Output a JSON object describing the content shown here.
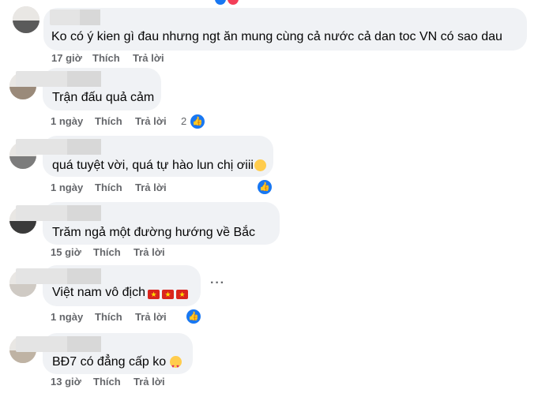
{
  "comments": [
    {
      "text": "Ko có ý kien gì đau nhưng ngt ăn mung cùng cả nước cả dan toc VN có sao dau",
      "time": "17 giờ",
      "like": "Thích",
      "reply": "Trả lời"
    },
    {
      "text": "Trận đấu quả cảm",
      "time": "1 ngày",
      "like": "Thích",
      "reply": "Trả lời",
      "reaction_count": "2"
    },
    {
      "text": "quá tuyệt vời, quá tự hào lun chị ơiii",
      "time": "1 ngày",
      "like": "Thích",
      "reply": "Trả lời"
    },
    {
      "text": "Trăm ngả một đường hướng về Bắc",
      "time": "15 giờ",
      "like": "Thích",
      "reply": "Trả lời"
    },
    {
      "text": "Việt nam vô địch",
      "time": "1 ngày",
      "like": "Thích",
      "reply": "Trả lời"
    },
    {
      "text": "BĐ7 có đẳng cấp ko",
      "time": "13 giờ",
      "like": "Thích",
      "reply": "Trả lời"
    }
  ],
  "icons": {
    "like_reaction": "thumbs-up-icon",
    "more": "more-options-icon",
    "flag": "vietnam-flag-emoji",
    "heart_eyes": "heart-eyes-emoji",
    "worried": "worried-face-emoji"
  },
  "colors": {
    "bubble": "#f0f2f5",
    "meta_text": "#65676b",
    "like_blue": "#1877f2",
    "flag_red": "#da251d",
    "flag_star": "#ffde00"
  }
}
